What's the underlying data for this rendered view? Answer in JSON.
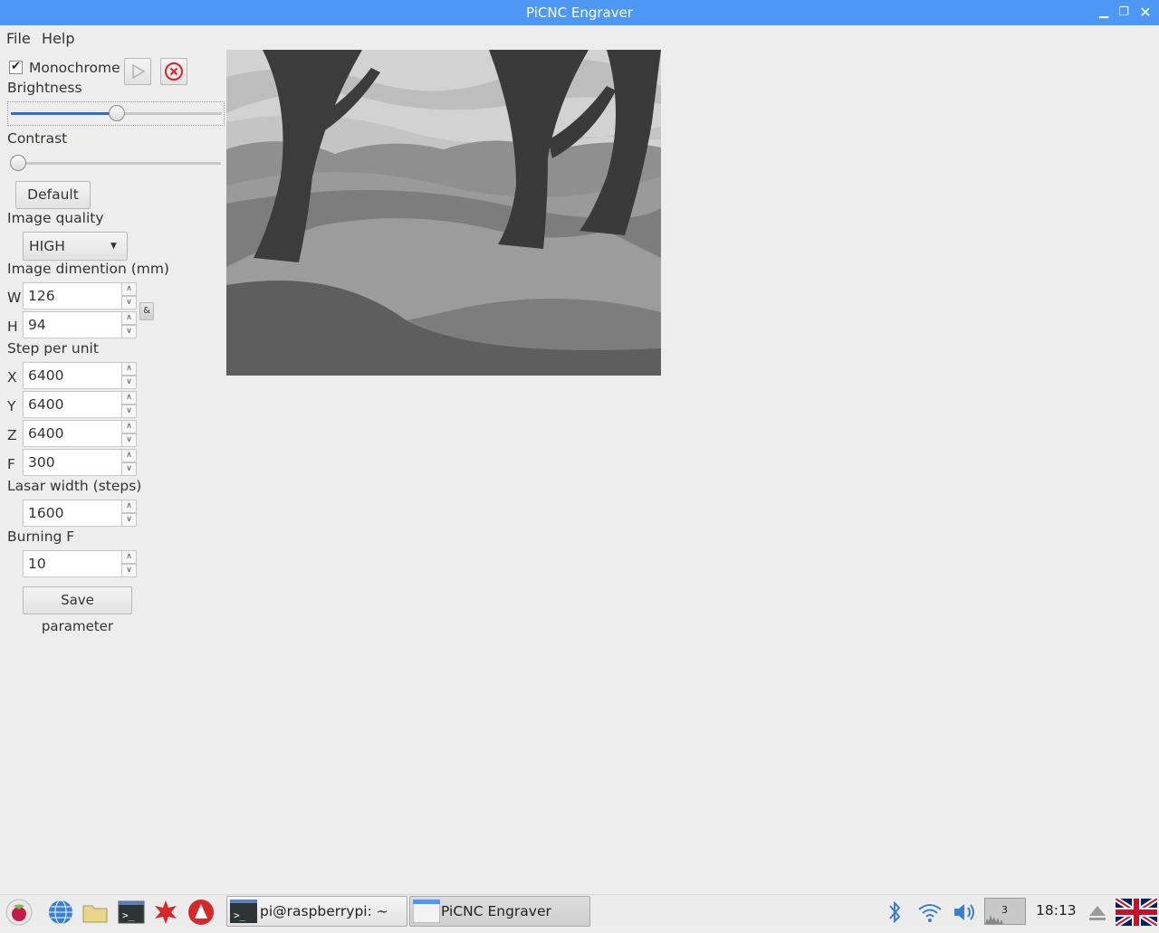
{
  "window": {
    "title": "PiCNC Engraver"
  },
  "menu": {
    "file": "File",
    "help": "Help"
  },
  "controls": {
    "monochrome_label": "Monochrome",
    "monochrome_checked": true,
    "brightness_label": "Brightness",
    "brightness_value": 0.5,
    "contrast_label": "Contrast",
    "contrast_value": 0.0,
    "default_button": "Default",
    "image_quality_label": "Image quality",
    "image_quality_value": "HIGH",
    "image_dimension_label": "Image dimention (mm)",
    "width_axis": "W",
    "width_value": "126",
    "height_axis": "H",
    "height_value": "94",
    "link_label": "&",
    "step_per_unit_label": "Step per unit",
    "x_axis": "X",
    "x_value": "6400",
    "y_axis": "Y",
    "y_value": "6400",
    "z_axis": "Z",
    "z_value": "6400",
    "f_axis": "F",
    "f_value": "300",
    "laser_width_label": "Lasar width (steps)",
    "laser_width_value": "1600",
    "burning_f_label": "Burning F",
    "burning_f_value": "10",
    "save_button": "Save parameter"
  },
  "taskbar": {
    "task_terminal": "pi@raspberrypi: ~",
    "task_app": "PiCNC Engraver",
    "cpu_value": "3",
    "clock": "18:13"
  },
  "colors": {
    "titlebar": "#4d98f5",
    "accent": "#2f6fcf",
    "stop": "#d9252a"
  }
}
